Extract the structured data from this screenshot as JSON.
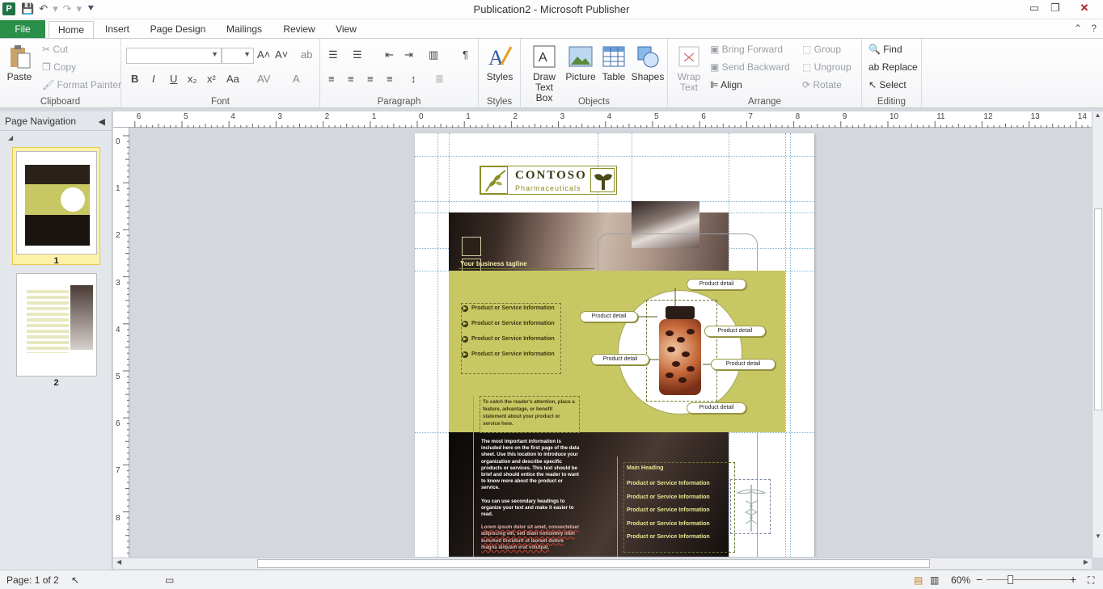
{
  "window": {
    "title": "Publication2 - Microsoft Publisher",
    "app_icon": "P",
    "qat": {
      "save": "💾",
      "undo": "↶",
      "undo_dd": "▾",
      "redo": "↷",
      "redo_dd": "▾",
      "more": "⯆"
    },
    "controls": {
      "minimize": "▭",
      "restore": "❐",
      "close": "✕"
    }
  },
  "tabs": {
    "file": "File",
    "home": "Home",
    "insert": "Insert",
    "page_design": "Page Design",
    "mailings": "Mailings",
    "review": "Review",
    "view": "View",
    "collapse_ribbon": "⌃",
    "help": "?"
  },
  "ribbon": {
    "clipboard": {
      "label": "Clipboard",
      "paste": "Paste",
      "cut": "Cut",
      "copy": "Copy",
      "format_painter": "Format Painter"
    },
    "font": {
      "label": "Font",
      "bold": "B",
      "italic": "I",
      "underline": "U",
      "subscript": "x₂",
      "superscript": "x²",
      "change_case": "Aa",
      "char_spacing": "AV",
      "font_color": "A",
      "grow": "A˄",
      "shrink": "A˅",
      "clear": "ab"
    },
    "paragraph": {
      "label": "Paragraph",
      "pilcrow": "¶"
    },
    "styles": {
      "label": "Styles",
      "styles": "Styles"
    },
    "objects": {
      "label": "Objects",
      "draw_text_box_1": "Draw",
      "draw_text_box_2": "Text Box",
      "picture": "Picture",
      "table": "Table",
      "shapes": "Shapes"
    },
    "arrange": {
      "label": "Arrange",
      "wrap_text_1": "Wrap",
      "wrap_text_2": "Text",
      "bring_forward": "Bring Forward",
      "send_backward": "Send Backward",
      "align": "Align",
      "group": "Group",
      "ungroup": "Ungroup",
      "rotate": "Rotate"
    },
    "editing": {
      "label": "Editing",
      "find": "Find",
      "replace": "Replace",
      "select": "Select"
    }
  },
  "nav": {
    "title": "Page Navigation",
    "collapse": "◀",
    "section_tri": "◢",
    "pages": [
      {
        "number": "1"
      },
      {
        "number": "2"
      }
    ]
  },
  "rulers": {
    "h": [
      "6",
      "5",
      "4",
      "3",
      "2",
      "1",
      "0",
      "1",
      "2",
      "3",
      "4",
      "5",
      "6",
      "7",
      "8",
      "9",
      "10",
      "11",
      "12",
      "13",
      "14"
    ],
    "v": [
      "0",
      "1",
      "2",
      "3",
      "4",
      "5",
      "6",
      "7",
      "8"
    ]
  },
  "document": {
    "logo_name": "CONTOSO",
    "logo_sub": "Pharmaceuticals",
    "tagline": "Your business tagline",
    "product_list": [
      "Product or Service Information",
      "Product or Service Information",
      "Product or Service Information",
      "Product or Service Information"
    ],
    "bullet": "▶",
    "product_details": [
      "Product detail",
      "Product detail",
      "Product detail",
      "Product detail",
      "Product detail",
      "Product detail"
    ],
    "callout": "To catch the reader's attention, place a feature, advantage, or benefit statement about your product or service here.",
    "body_1": "The most important information is included here on the first page of the data sheet. Use this location to introduce your organization and describe specific products or services. This text should be brief and should entice the reader to want to know more about the product or service.",
    "body_2": "You can use secondary headings to organize your text and make it easier to read.",
    "body_3": "Lorem ipsum dolor sit amet, consectetuer adipiscing elit, sed diam nonummy nibh euismod tincidunt ut laoreet dolore magna aliquam erat volutpat.",
    "main_heading": "Main Heading",
    "main_items": [
      "Product or Service Information",
      "Product or Service Information",
      "Product or Service Information",
      "Product or Service Information",
      "Product or Service Information"
    ]
  },
  "status": {
    "page": "Page: 1 of 2",
    "zoom": "60%",
    "zoom_out": "−",
    "zoom_in": "+"
  },
  "colors": {
    "accent": "#2a8f49",
    "olive": "#c7c764",
    "olive_dark": "#8b8f2a"
  }
}
